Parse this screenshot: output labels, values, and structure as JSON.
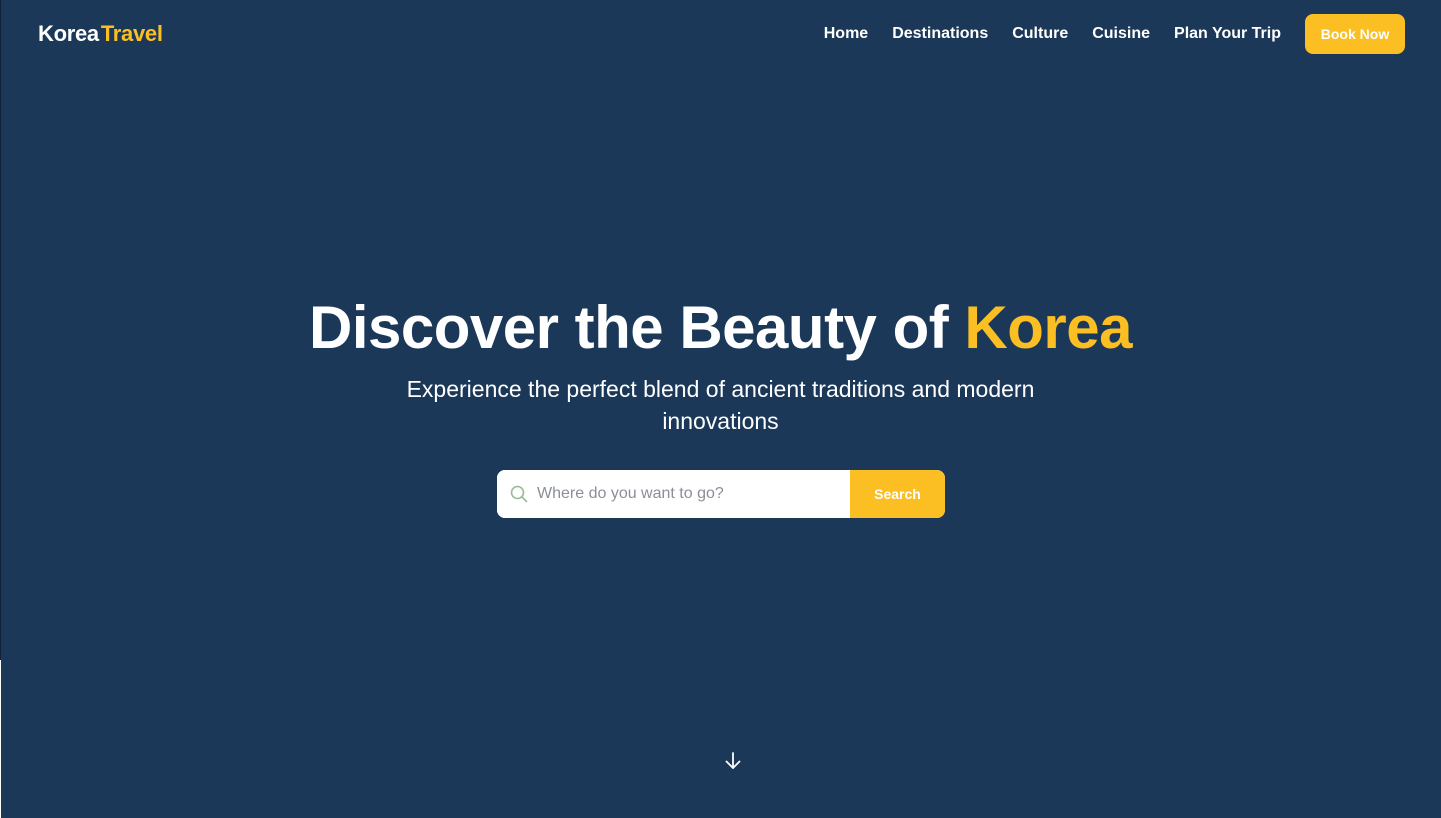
{
  "brand": {
    "logo_part1": "Korea",
    "logo_part2": "Travel"
  },
  "nav": {
    "items": [
      {
        "label": "Home"
      },
      {
        "label": "Destinations"
      },
      {
        "label": "Culture"
      },
      {
        "label": "Cuisine"
      },
      {
        "label": "Plan Your Trip"
      }
    ],
    "book_label": "Book Now"
  },
  "hero": {
    "title_main": "Discover the Beauty of ",
    "title_accent": "Korea",
    "subtitle": "Experience the perfect blend of ancient traditions and modern innovations",
    "search": {
      "placeholder": "Where do you want to go?",
      "value": "",
      "button_label": "Search"
    }
  },
  "icons": {
    "search": "search-icon",
    "scroll": "arrow-down-icon"
  },
  "colors": {
    "background": "#1b3858",
    "accent": "#fbbf24",
    "text": "#ffffff"
  }
}
